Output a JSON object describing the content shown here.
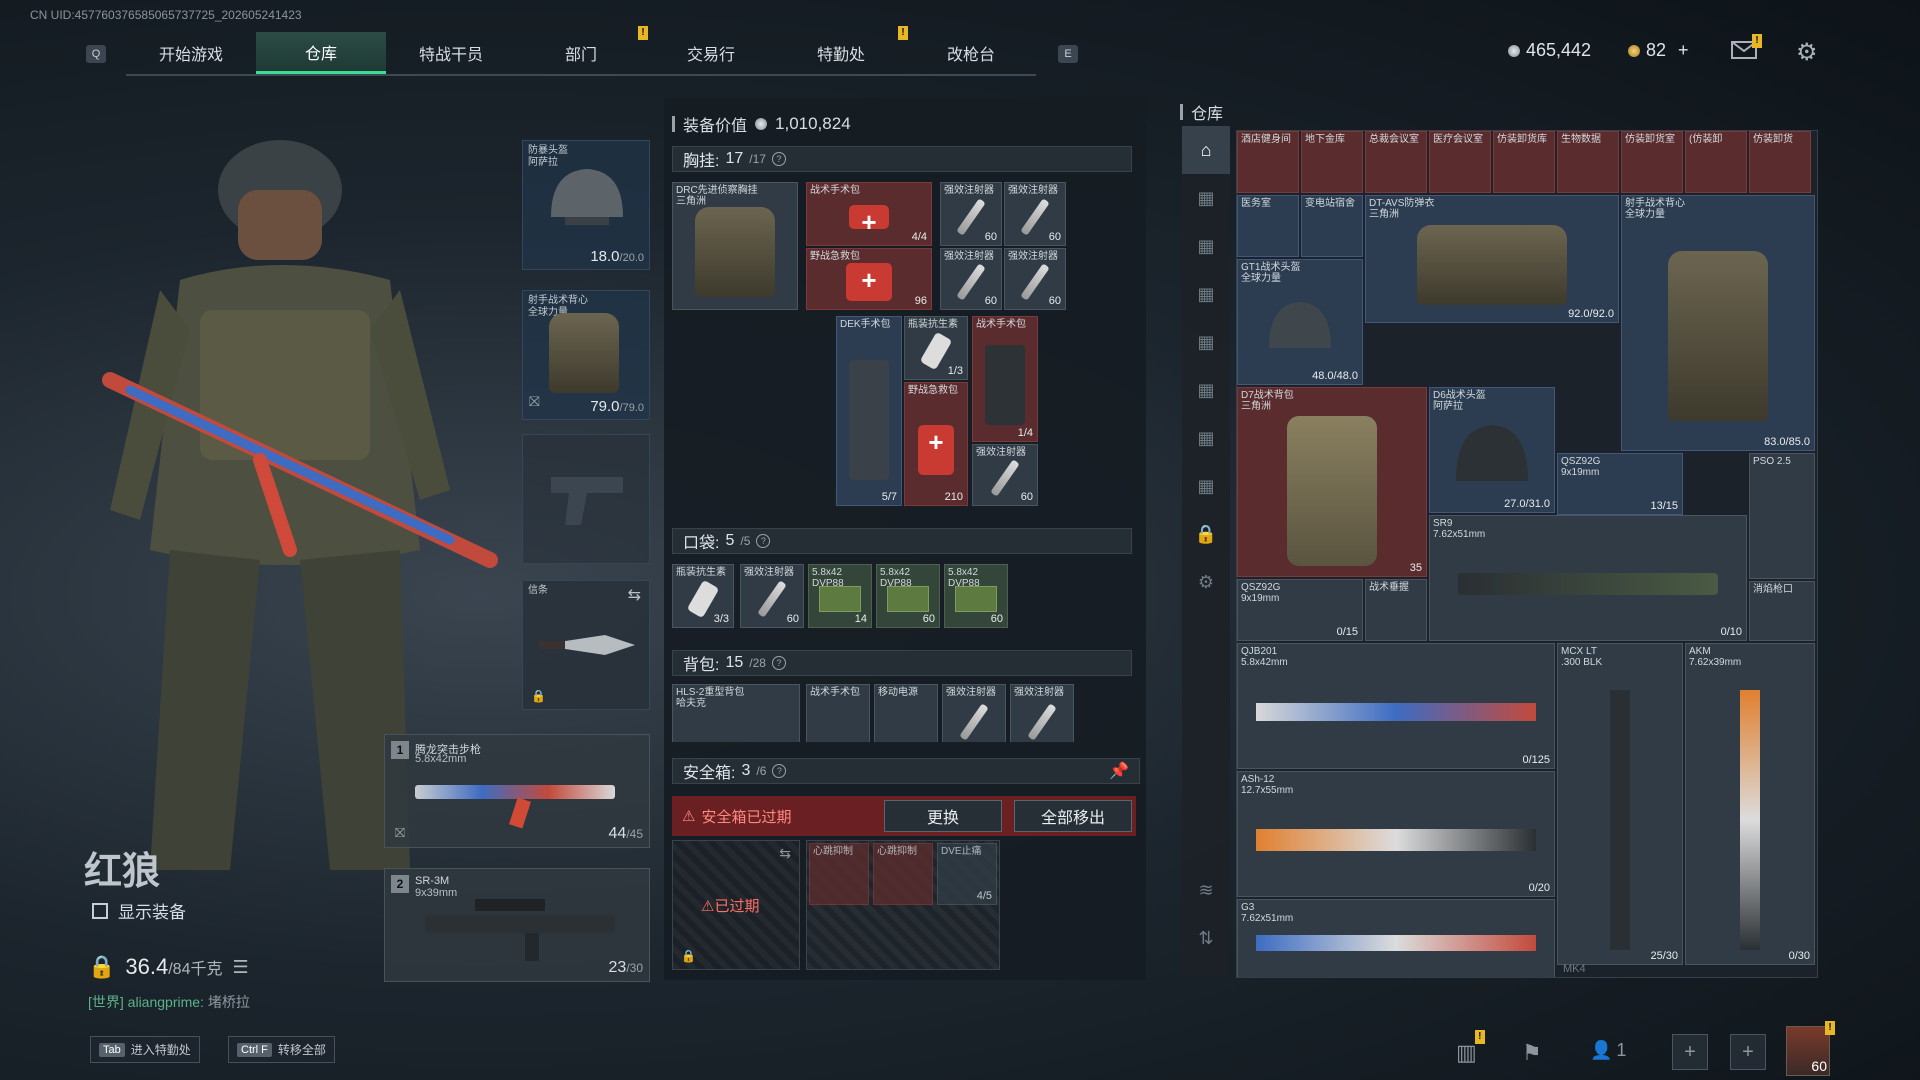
{
  "uid_text": "CN UID:457760376585065737725_202605241423",
  "nav": {
    "key_left": "Q",
    "key_right": "E",
    "tabs": [
      "开始游戏",
      "仓库",
      "特战干员",
      "部门",
      "交易行",
      "特勤处",
      "改枪台"
    ],
    "active": "仓库"
  },
  "currency": {
    "silver": "465,442",
    "gold": "82",
    "plus": "+"
  },
  "operator": {
    "name": "红狼",
    "show_gear": "显示装备",
    "weight": "36.4",
    "weight_max": "/84千克",
    "world_channel": "[世界]",
    "world_user": "aliangprime",
    "world_msg": "堵桥拉"
  },
  "gear": {
    "helmet": {
      "label": "防暴头盔\n阿萨拉",
      "val": "18.0",
      "max": "/20.0"
    },
    "armor": {
      "label": "射手战术背心\n全球力量",
      "val": "79.0",
      "max": "/79.0"
    },
    "melee": {
      "label": "信条"
    },
    "weapon1": {
      "num": "1",
      "name": "腾龙突击步枪",
      "cal": "5.8x42mm",
      "ammo": "44",
      "max": "/45"
    },
    "weapon2": {
      "num": "2",
      "name": "SR-3M",
      "cal": "9x39mm",
      "ammo": "23",
      "max": "/30"
    }
  },
  "loadout": {
    "value_label": "装备价值",
    "value": "1,010,824",
    "chest": {
      "label": "胸挂:",
      "val": "17",
      "max": "/17"
    },
    "pocket": {
      "label": "口袋:",
      "val": "5",
      "max": "/5"
    },
    "backpack": {
      "label": "背包:",
      "val": "15",
      "max": "/28"
    },
    "safebox": {
      "label": "安全箱:",
      "val": "3",
      "max": "/6"
    },
    "safebox_expired": "安全箱已过期",
    "replace": "更换",
    "move_all": "全部移出",
    "expired_tag": "已过期",
    "chest_items": [
      {
        "name": "DRC先进侦察胸挂\n三角洲",
        "count": ""
      },
      {
        "name": "战术手术包",
        "count": "4/4"
      },
      {
        "name": "强效注射器",
        "count": "60"
      },
      {
        "name": "强效注射器",
        "count": "60"
      },
      {
        "name": "野战急救包",
        "count": "96"
      },
      {
        "name": "强效注射器",
        "count": "60"
      },
      {
        "name": "强效注射器",
        "count": "60"
      },
      {
        "name": "DEK手术包",
        "count": "5/7"
      },
      {
        "name": "瓶装抗生素",
        "count": "1/3"
      },
      {
        "name": "野战急救包",
        "count": "210"
      },
      {
        "name": "战术手术包",
        "count": "1/4"
      },
      {
        "name": "强效注射器",
        "count": "60"
      }
    ],
    "pocket_items": [
      {
        "name": "瓶装抗生素",
        "count": "3/3"
      },
      {
        "name": "强效注射器",
        "count": "60"
      },
      {
        "name": "5.8x42\nDVP88",
        "count": "14"
      },
      {
        "name": "5.8x42\nDVP88",
        "count": "60"
      },
      {
        "name": "5.8x42\nDVP88",
        "count": "60"
      }
    ],
    "backpack_items": [
      "HLS-2重型背包\n哈夫克",
      "战术手术包",
      "移动电源",
      "强效注射器",
      "强效注射器"
    ],
    "safebox_items": [
      {
        "name": "心跳抑制",
        "count": ""
      },
      {
        "name": "心跳抑制",
        "count": ""
      },
      {
        "name": "DVE止痛",
        "count": "4/5"
      }
    ]
  },
  "warehouse": {
    "title": "仓库",
    "keys": [
      "酒店健身间",
      "地下金库",
      "总裁会议室",
      "医疗会议室",
      "仿装卸货库",
      "生物数据",
      "仿装卸货室",
      "(仿装卸",
      "仿装卸货"
    ],
    "keys2": [
      "医务室",
      "变电站宿舍"
    ],
    "items": [
      {
        "name": "DT-AVS防弹衣\n三角洲",
        "count": "92.0/92.0"
      },
      {
        "name": "射手战术背心\n全球力量",
        "count": "83.0/85.0"
      },
      {
        "name": "GT1战术头盔\n全球力量",
        "count": "48.0/48.0"
      },
      {
        "name": "D7战术背包\n三角洲",
        "count": "35"
      },
      {
        "name": "D6战术头盔\n阿萨拉",
        "count": "27.0/31.0"
      },
      {
        "name": "QSZ92G\n9x19mm",
        "count": "13/15"
      },
      {
        "name": "PSO 2.5",
        "count": ""
      },
      {
        "name": "SR9\n7.62x51mm",
        "count": "0/10"
      },
      {
        "name": "QSZ92G\n9x19mm",
        "count": "0/15"
      },
      {
        "name": "战术垂握",
        "count": ""
      },
      {
        "name": "消焰枪口",
        "count": ""
      },
      {
        "name": "QJB201\n5.8x42mm",
        "count": "0/125"
      },
      {
        "name": "MCX LT\n.300 BLK",
        "count": "25/30"
      },
      {
        "name": "AKM\n7.62x39mm",
        "count": "0/30"
      },
      {
        "name": "ASh-12\n12.7x55mm",
        "count": "0/20"
      },
      {
        "name": "G3\n7.62x51mm",
        "count": ""
      },
      {
        "name": "MK4",
        "count": ""
      }
    ]
  },
  "hints": [
    {
      "key": "Tab",
      "label": "进入特勤处"
    },
    {
      "key": "Ctrl F",
      "label": "转移全部"
    }
  ],
  "squad_count": "1",
  "level": "60",
  "colors": {
    "accent": "#3ddc97",
    "notif": "#e8b726",
    "danger": "#d94848"
  }
}
